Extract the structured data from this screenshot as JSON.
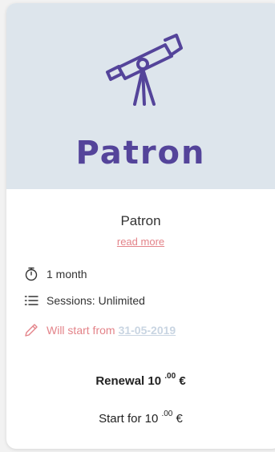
{
  "hero": {
    "title": "Patron",
    "icon": "telescope-icon"
  },
  "plan": {
    "name": "Patron",
    "read_more": "read more"
  },
  "details": [
    {
      "icon": "timer-icon",
      "text": "1 month"
    },
    {
      "icon": "list-icon",
      "text": "Sessions: Unlimited"
    }
  ],
  "start": {
    "icon": "pencil-icon",
    "prefix": "Will start from",
    "date": "31-05-2019"
  },
  "prices": {
    "renewal_label": "Renewal 10",
    "renewal_cents": ".00",
    "renewal_currency": "€",
    "start_label": "Start for 10",
    "start_cents": ".00",
    "start_currency": "€"
  },
  "colors": {
    "brand": "#54449a",
    "accent": "#e38389",
    "hero_bg": "#dde5ec",
    "date_link": "#c9d5e2"
  }
}
